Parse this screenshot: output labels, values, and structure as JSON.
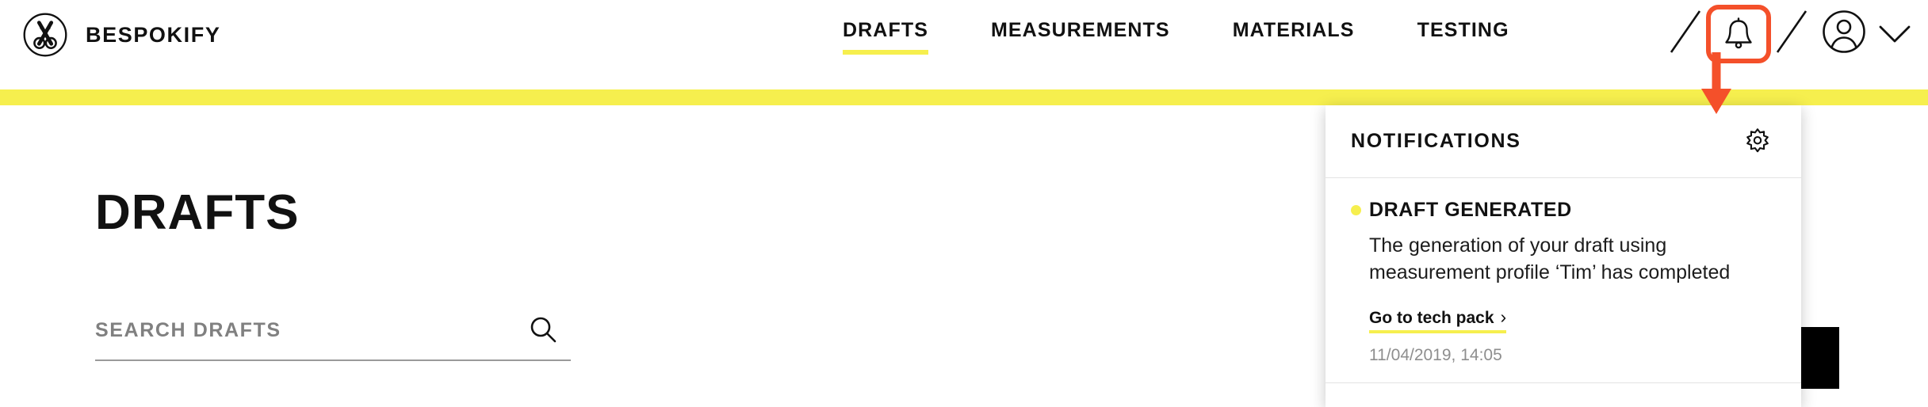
{
  "brand": {
    "name": "BESPOKIFY",
    "logo_icon": "scissors-circle-icon"
  },
  "nav": {
    "items": [
      {
        "label": "DRAFTS",
        "active": true
      },
      {
        "label": "MEASUREMENTS",
        "active": false
      },
      {
        "label": "MATERIALS",
        "active": false
      },
      {
        "label": "TESTING",
        "active": false
      }
    ]
  },
  "header_actions": {
    "separator_icon": "slash-separator-icon",
    "bell_icon": "notification-bell-icon",
    "avatar_icon": "user-avatar-icon",
    "chevron_icon": "chevron-down-icon",
    "bell_highlight_color": "#f4502a"
  },
  "accent": {
    "yellow": "#f6ef4e",
    "highlight_red": "#f4502a",
    "muted_text": "#808080"
  },
  "main": {
    "page_title": "DRAFTS",
    "search": {
      "placeholder": "SEARCH DRAFTS",
      "value": "",
      "icon": "search-icon"
    }
  },
  "notifications": {
    "header_title": "NOTIFICATIONS",
    "settings_icon": "gear-icon",
    "items": [
      {
        "unread": true,
        "title": "DRAFT GENERATED",
        "body": "The generation of your draft using measurement profile ‘Tim’ has completed",
        "link_label": "Go to tech pack",
        "link_chevron": "›",
        "timestamp": "11/04/2019, 14:05"
      }
    ]
  },
  "annotation": {
    "arrow_icon": "red-down-arrow-annotation",
    "color": "#f4502a"
  }
}
